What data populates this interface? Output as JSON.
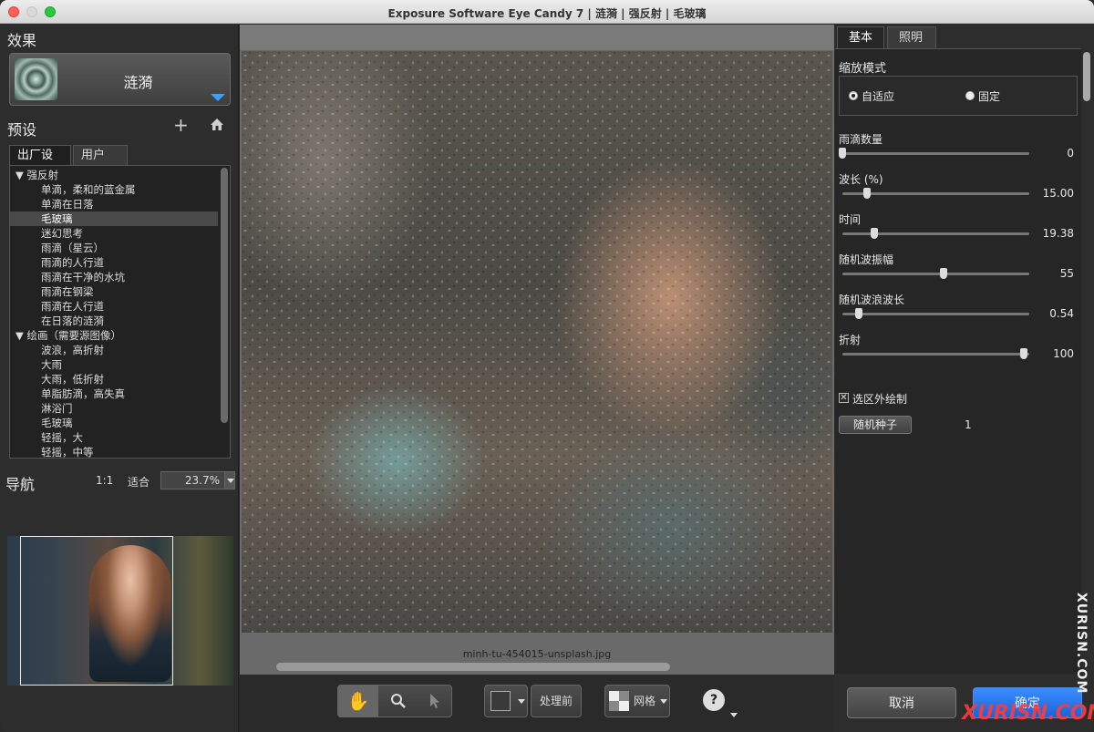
{
  "window": {
    "title": "Exposure Software Eye Candy 7 | 涟漪 | 强反射 | 毛玻璃"
  },
  "effect": {
    "heading": "效果",
    "name": "涟漪"
  },
  "presets": {
    "heading": "预设",
    "tabs": [
      "出厂设置",
      "用户"
    ],
    "items": [
      {
        "label": "▼ 强反射",
        "group": true
      },
      {
        "label": "单滴，柔和的蓝金属"
      },
      {
        "label": "单滴在日落"
      },
      {
        "label": "毛玻璃",
        "selected": true
      },
      {
        "label": "迷幻思考"
      },
      {
        "label": "雨滴（星云）"
      },
      {
        "label": "雨滴的人行道"
      },
      {
        "label": "雨滴在干净的水坑"
      },
      {
        "label": "雨滴在钢梁"
      },
      {
        "label": "雨滴在人行道"
      },
      {
        "label": "在日落的涟漪"
      },
      {
        "label": "▼ 绘画（需要源图像）",
        "group": true
      },
      {
        "label": "波浪，高折射"
      },
      {
        "label": "大雨"
      },
      {
        "label": "大雨，低折射"
      },
      {
        "label": "单脂肪滴，高失真"
      },
      {
        "label": "淋浴门"
      },
      {
        "label": "毛玻璃"
      },
      {
        "label": "轻摇，大"
      },
      {
        "label": "轻摇，中等"
      }
    ]
  },
  "navigation": {
    "heading": "导航",
    "one_to_one": "1:1",
    "fit": "适合",
    "zoom": "23.7%"
  },
  "preview": {
    "filename": "minh-tu-454015-unsplash.jpg"
  },
  "toolbar": {
    "before_label": "处理前",
    "grid_label": "网格",
    "help": "?"
  },
  "settings": {
    "tabs": [
      "基本",
      "照明"
    ],
    "scale_mode_label": "缩放模式",
    "scale_modes": [
      {
        "label": "自适应",
        "selected": true
      },
      {
        "label": "固定",
        "selected": false
      }
    ],
    "sliders": [
      {
        "label": "雨滴数量",
        "value": "0",
        "fraction": 0.0
      },
      {
        "label": "波长 (%)",
        "value": "15.00",
        "fraction": 0.13
      },
      {
        "label": "时间",
        "value": "19.38",
        "fraction": 0.17
      },
      {
        "label": "随机波振幅",
        "value": "55",
        "fraction": 0.54
      },
      {
        "label": "随机波浪波长",
        "value": "0.54",
        "fraction": 0.09
      },
      {
        "label": "折射",
        "value": "100",
        "fraction": 0.97
      }
    ],
    "outside_selection_label": "选区外绘制",
    "outside_selection_checked": true,
    "random_seed_label": "随机种子",
    "random_seed_value": "1"
  },
  "footer": {
    "cancel": "取消",
    "ok": "确定"
  },
  "watermark": {
    "vertical": "XURISN.COM",
    "bottom": "XURISN.COM"
  }
}
